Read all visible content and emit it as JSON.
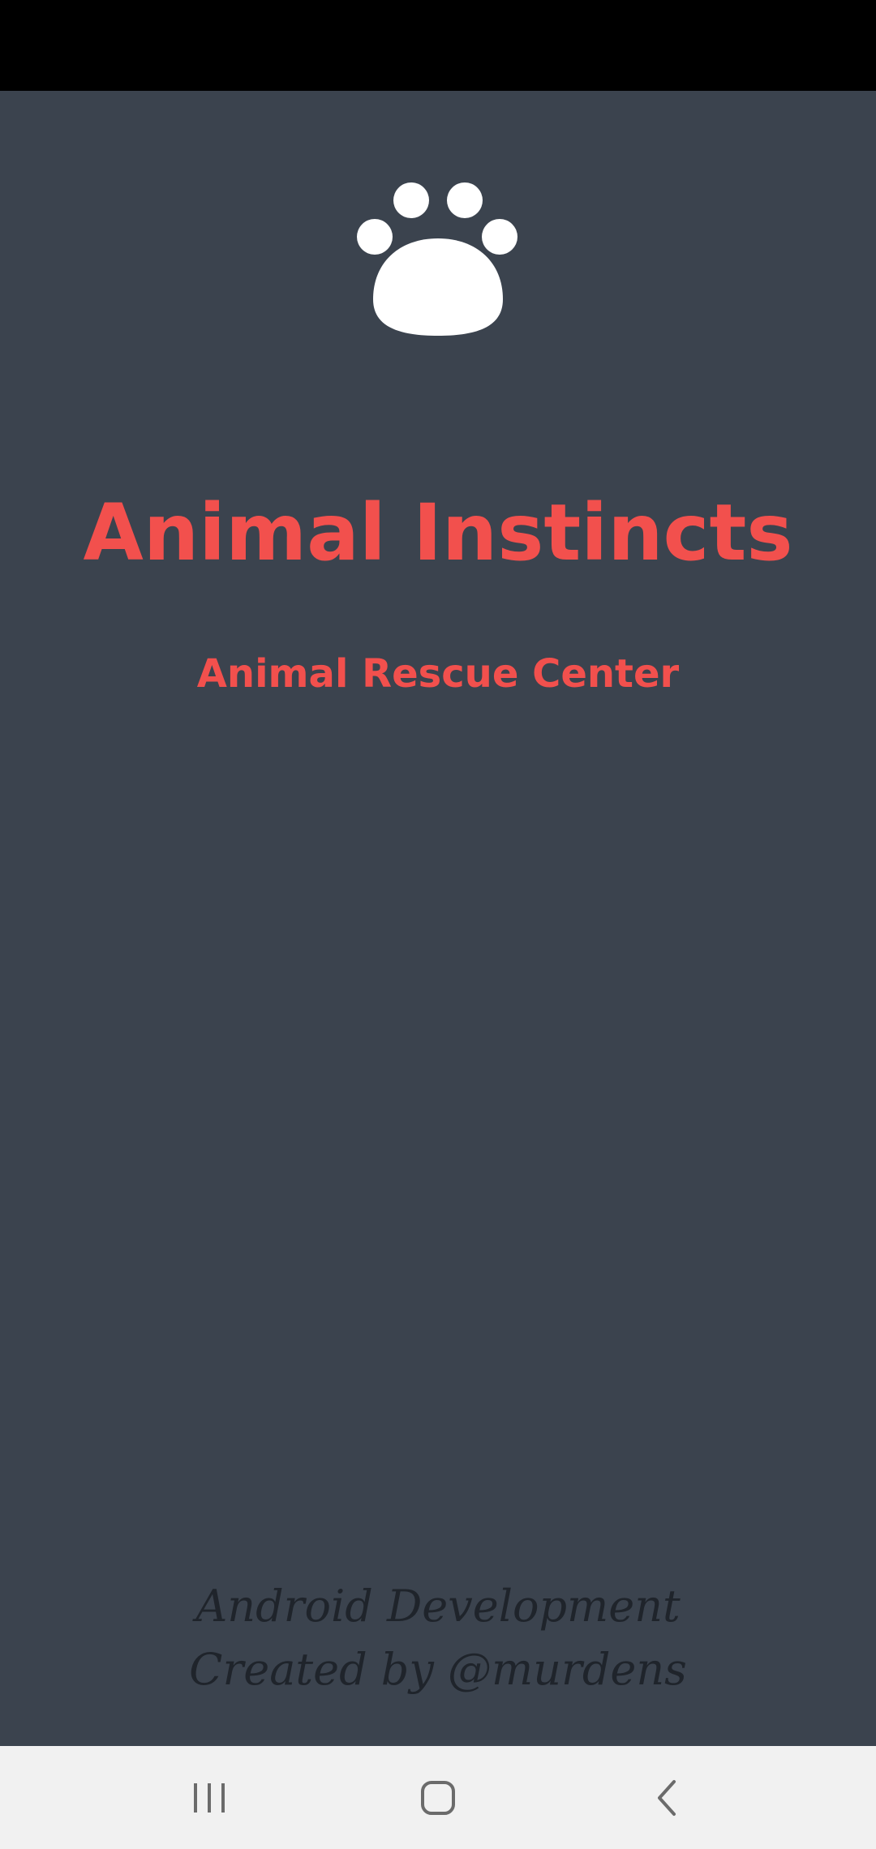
{
  "app": {
    "title": "Animal Instincts",
    "subtitle": "Animal Rescue Center",
    "logo_icon": "paw-icon",
    "credits": {
      "line1": "Android Development",
      "line2": "Created by @murdens"
    }
  },
  "colors": {
    "background": "#3b434e",
    "accent": "#f2504d",
    "credits_text": "#1f242b",
    "status_bar": "#000000",
    "nav_bar": "#f1f1f1"
  },
  "nav_bar": {
    "buttons": [
      {
        "icon": "recents-icon"
      },
      {
        "icon": "home-icon"
      },
      {
        "icon": "back-icon"
      }
    ]
  }
}
